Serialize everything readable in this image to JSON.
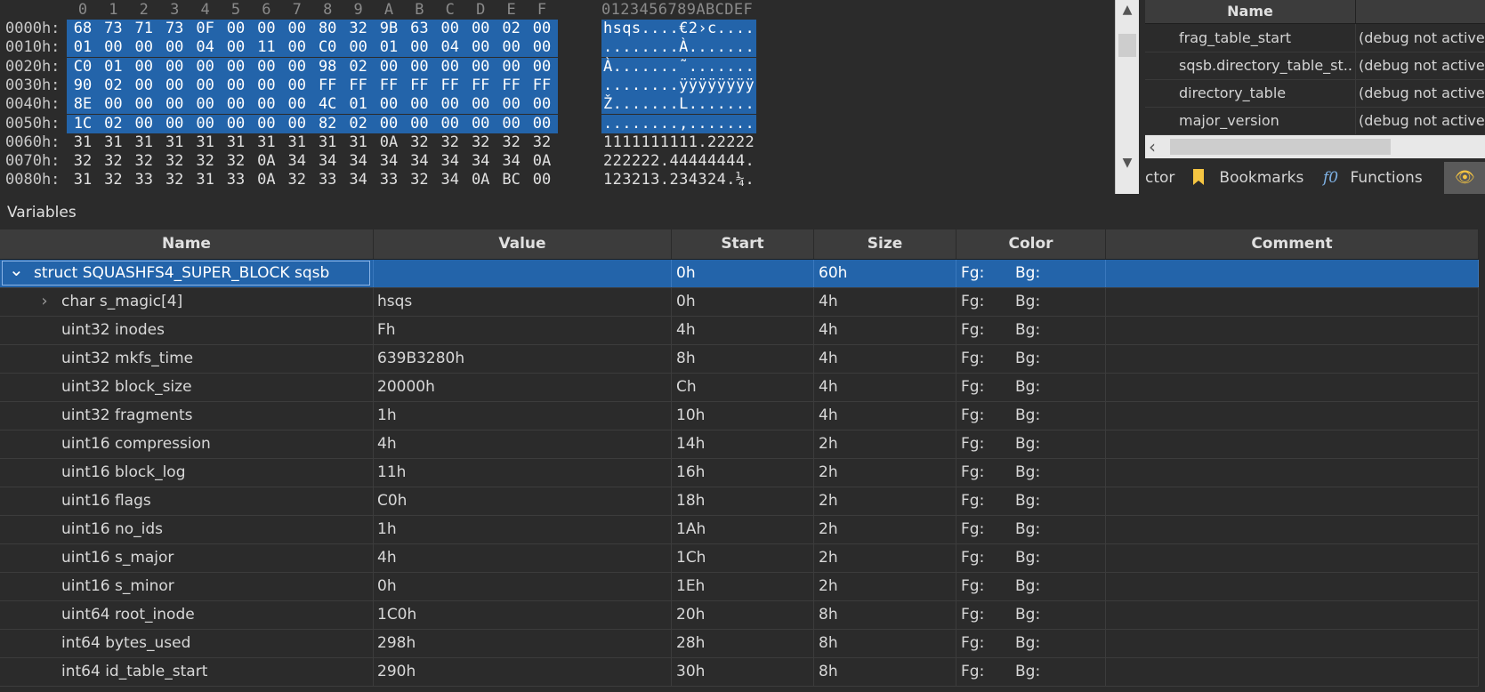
{
  "hex_view": {
    "column_labels": [
      "0",
      "1",
      "2",
      "3",
      "4",
      "5",
      "6",
      "7",
      "8",
      "9",
      "A",
      "B",
      "C",
      "D",
      "E",
      "F"
    ],
    "ascii_header": "0123456789ABCDEF",
    "rows": [
      {
        "addr": "0000h:",
        "bytes": [
          "68",
          "73",
          "71",
          "73",
          "0F",
          "00",
          "00",
          "00",
          "80",
          "32",
          "9B",
          "63",
          "00",
          "00",
          "02",
          "00"
        ],
        "ascii": "hsqs....€2›c....",
        "selected": true
      },
      {
        "addr": "0010h:",
        "bytes": [
          "01",
          "00",
          "00",
          "00",
          "04",
          "00",
          "11",
          "00",
          "C0",
          "00",
          "01",
          "00",
          "04",
          "00",
          "00",
          "00"
        ],
        "ascii": "........À.......",
        "selected": true
      },
      {
        "addr": "0020h:",
        "bytes": [
          "C0",
          "01",
          "00",
          "00",
          "00",
          "00",
          "00",
          "00",
          "98",
          "02",
          "00",
          "00",
          "00",
          "00",
          "00",
          "00"
        ],
        "ascii": "À.......˜.......",
        "selected": true
      },
      {
        "addr": "0030h:",
        "bytes": [
          "90",
          "02",
          "00",
          "00",
          "00",
          "00",
          "00",
          "00",
          "FF",
          "FF",
          "FF",
          "FF",
          "FF",
          "FF",
          "FF",
          "FF"
        ],
        "ascii": "........ÿÿÿÿÿÿÿÿ",
        "selected": true
      },
      {
        "addr": "0040h:",
        "bytes": [
          "8E",
          "00",
          "00",
          "00",
          "00",
          "00",
          "00",
          "00",
          "4C",
          "01",
          "00",
          "00",
          "00",
          "00",
          "00",
          "00"
        ],
        "ascii": "Ž.......L.......",
        "selected": true
      },
      {
        "addr": "0050h:",
        "bytes": [
          "1C",
          "02",
          "00",
          "00",
          "00",
          "00",
          "00",
          "00",
          "82",
          "02",
          "00",
          "00",
          "00",
          "00",
          "00",
          "00"
        ],
        "ascii": "........‚.......",
        "selected": true
      },
      {
        "addr": "0060h:",
        "bytes": [
          "31",
          "31",
          "31",
          "31",
          "31",
          "31",
          "31",
          "31",
          "31",
          "31",
          "0A",
          "32",
          "32",
          "32",
          "32",
          "32"
        ],
        "ascii": "1111111111.22222",
        "selected": false
      },
      {
        "addr": "0070h:",
        "bytes": [
          "32",
          "32",
          "32",
          "32",
          "32",
          "32",
          "0A",
          "34",
          "34",
          "34",
          "34",
          "34",
          "34",
          "34",
          "34",
          "0A"
        ],
        "ascii": "222222.44444444.",
        "selected": false
      },
      {
        "addr": "0080h:",
        "bytes": [
          "31",
          "32",
          "33",
          "32",
          "31",
          "33",
          "0A",
          "32",
          "33",
          "34",
          "33",
          "32",
          "34",
          "0A",
          "BC",
          "00"
        ],
        "ascii": "123213.234324.¼.",
        "selected": false
      }
    ]
  },
  "hex_scrollbar": {
    "up_icon": "▲",
    "down_icon": "▼"
  },
  "right_panel": {
    "header_name": "Name",
    "rows": [
      {
        "name": "frag_table_start",
        "value": "(debug not active"
      },
      {
        "name": "sqsb.directory_table_st...",
        "value": "(debug not active"
      },
      {
        "name": "directory_table",
        "value": "(debug not active"
      },
      {
        "name": "major_version",
        "value": "(debug not active"
      }
    ],
    "hscroll_left_icon": "‹",
    "tabs": {
      "inspector_partial": "ctor",
      "bookmarks": "Bookmarks",
      "functions_icon": "f0",
      "functions": "Functions",
      "watch_icon": "👁"
    }
  },
  "variables": {
    "title": "Variables",
    "columns": [
      "Name",
      "Value",
      "Start",
      "Size",
      "Color",
      "Comment"
    ],
    "rows": [
      {
        "name": "struct SQUASHFS4_SUPER_BLOCK sqsb",
        "value": "",
        "start": "0h",
        "size": "60h",
        "fg": "Fg:",
        "bg": "Bg:",
        "comment": "",
        "expander": "expanded",
        "selected": true,
        "indent": 0
      },
      {
        "name": "char s_magic[4]",
        "value": "hsqs",
        "start": "0h",
        "size": "4h",
        "fg": "Fg:",
        "bg": "Bg:",
        "comment": "",
        "expander": "collapsed",
        "selected": false,
        "indent": 1
      },
      {
        "name": "uint32 inodes",
        "value": "Fh",
        "start": "4h",
        "size": "4h",
        "fg": "Fg:",
        "bg": "Bg:",
        "comment": "",
        "expander": "none",
        "selected": false,
        "indent": 1
      },
      {
        "name": "uint32 mkfs_time",
        "value": "639B3280h",
        "start": "8h",
        "size": "4h",
        "fg": "Fg:",
        "bg": "Bg:",
        "comment": "",
        "expander": "none",
        "selected": false,
        "indent": 1
      },
      {
        "name": "uint32 block_size",
        "value": "20000h",
        "start": "Ch",
        "size": "4h",
        "fg": "Fg:",
        "bg": "Bg:",
        "comment": "",
        "expander": "none",
        "selected": false,
        "indent": 1
      },
      {
        "name": "uint32 fragments",
        "value": "1h",
        "start": "10h",
        "size": "4h",
        "fg": "Fg:",
        "bg": "Bg:",
        "comment": "",
        "expander": "none",
        "selected": false,
        "indent": 1
      },
      {
        "name": "uint16 compression",
        "value": "4h",
        "start": "14h",
        "size": "2h",
        "fg": "Fg:",
        "bg": "Bg:",
        "comment": "",
        "expander": "none",
        "selected": false,
        "indent": 1
      },
      {
        "name": "uint16 block_log",
        "value": "11h",
        "start": "16h",
        "size": "2h",
        "fg": "Fg:",
        "bg": "Bg:",
        "comment": "",
        "expander": "none",
        "selected": false,
        "indent": 1
      },
      {
        "name": "uint16 flags",
        "value": "C0h",
        "start": "18h",
        "size": "2h",
        "fg": "Fg:",
        "bg": "Bg:",
        "comment": "",
        "expander": "none",
        "selected": false,
        "indent": 1
      },
      {
        "name": "uint16 no_ids",
        "value": "1h",
        "start": "1Ah",
        "size": "2h",
        "fg": "Fg:",
        "bg": "Bg:",
        "comment": "",
        "expander": "none",
        "selected": false,
        "indent": 1
      },
      {
        "name": "uint16 s_major",
        "value": "4h",
        "start": "1Ch",
        "size": "2h",
        "fg": "Fg:",
        "bg": "Bg:",
        "comment": "",
        "expander": "none",
        "selected": false,
        "indent": 1
      },
      {
        "name": "uint16 s_minor",
        "value": "0h",
        "start": "1Eh",
        "size": "2h",
        "fg": "Fg:",
        "bg": "Bg:",
        "comment": "",
        "expander": "none",
        "selected": false,
        "indent": 1
      },
      {
        "name": "uint64 root_inode",
        "value": "1C0h",
        "start": "20h",
        "size": "8h",
        "fg": "Fg:",
        "bg": "Bg:",
        "comment": "",
        "expander": "none",
        "selected": false,
        "indent": 1
      },
      {
        "name": "int64 bytes_used",
        "value": "298h",
        "start": "28h",
        "size": "8h",
        "fg": "Fg:",
        "bg": "Bg:",
        "comment": "",
        "expander": "none",
        "selected": false,
        "indent": 1
      },
      {
        "name": "int64 id_table_start",
        "value": "290h",
        "start": "30h",
        "size": "8h",
        "fg": "Fg:",
        "bg": "Bg:",
        "comment": "",
        "expander": "none",
        "selected": false,
        "indent": 1
      }
    ]
  },
  "colors": {
    "selection": "#2364aa",
    "background": "#2b2b2b",
    "header": "#3c3c3c"
  }
}
